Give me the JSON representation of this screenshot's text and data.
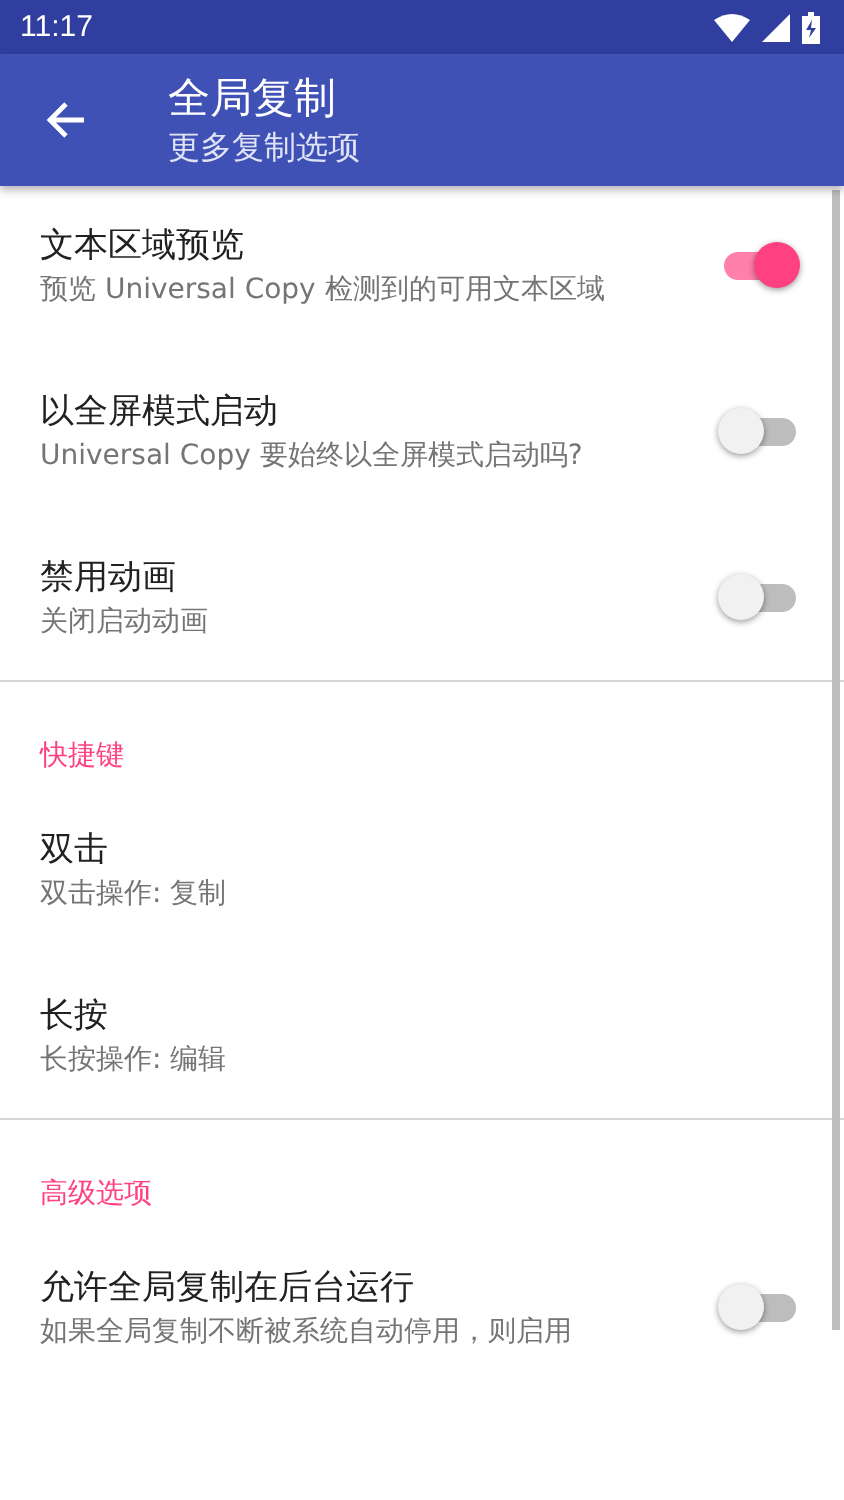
{
  "status_bar": {
    "time": "11:17"
  },
  "app_bar": {
    "title": "全局复制",
    "subtitle": "更多复制选项"
  },
  "sections": [
    {
      "items": [
        {
          "kind": "switch",
          "title": "文本区域预览",
          "summary": "预览 Universal Copy 检测到的可用文本区域",
          "on": true
        },
        {
          "kind": "switch",
          "title": "以全屏模式启动",
          "summary": "Universal Copy 要始终以全屏模式启动吗?",
          "on": false
        },
        {
          "kind": "switch",
          "title": "禁用动画",
          "summary": "关闭启动动画",
          "on": false
        }
      ]
    },
    {
      "header": "快捷键",
      "items": [
        {
          "kind": "plain",
          "title": "双击",
          "summary": "双击操作: 复制"
        },
        {
          "kind": "plain",
          "title": "长按",
          "summary": "长按操作: 编辑"
        }
      ]
    },
    {
      "header": "高级选项",
      "items": [
        {
          "kind": "switch",
          "title": "允许全局复制在后台运行",
          "summary": "如果全局复制不断被系统自动停用，则启用",
          "on": false
        }
      ]
    }
  ]
}
